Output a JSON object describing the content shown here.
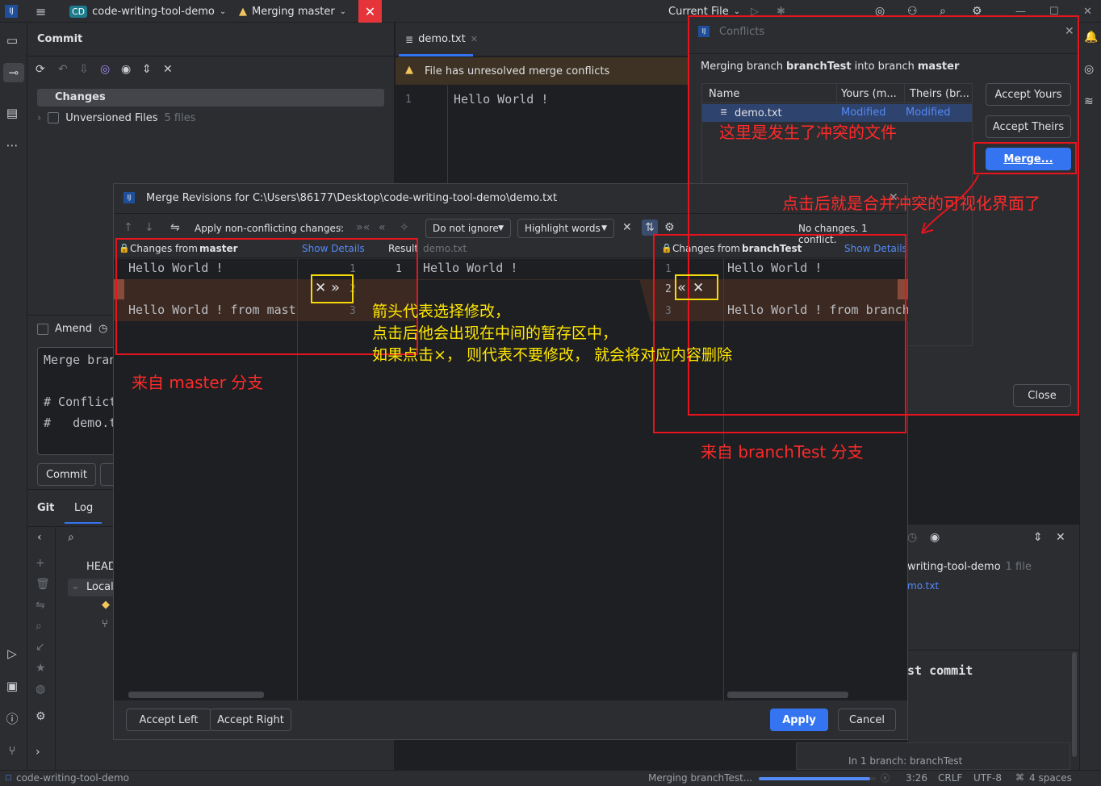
{
  "titlebar": {
    "project_badge": "CD",
    "project_name": "code-writing-tool-demo",
    "branch_status": "Merging master",
    "run_config": "Current File"
  },
  "commit_panel": {
    "title": "Commit",
    "changes_label": "Changes",
    "unversioned_label": "Unversioned Files",
    "unversioned_count": "5 files",
    "amend_label": "Amend",
    "commit_msg_line1": "Merge bran",
    "commit_msg_line3": "# Conflict",
    "commit_msg_line4": "#   demo.t",
    "commit_button": "Commit"
  },
  "git_panel": {
    "tab_git": "Git",
    "tab_log": "Log",
    "head_label": "HEAD",
    "local_label": "Local",
    "repo_label": "writing-tool-demo",
    "repo_files": "1 file",
    "file_label": "mo.txt",
    "commit_title": "st commit",
    "branch_info": "In 1 branch: branchTest"
  },
  "editor": {
    "tab_label": "demo.txt",
    "warning": "File has unresolved merge conflicts",
    "line_number": "1",
    "line_text": "Hello World !"
  },
  "conflicts_dialog": {
    "title": "Conflicts",
    "merging_prefix": "Merging branch",
    "source_branch": "branchTest",
    "merging_mid": "into branch",
    "target_branch": "master",
    "col_name": "Name",
    "col_yours": "Yours (m...",
    "col_theirs": "Theirs (br...",
    "row_file": "demo.txt",
    "row_yours": "Modified",
    "row_theirs": "Modified",
    "accept_yours": "Accept Yours",
    "accept_theirs": "Accept Theirs",
    "merge": "Merge...",
    "close": "Close"
  },
  "merge_dialog": {
    "title": "Merge Revisions for C:\\Users\\86177\\Desktop\\code-writing-tool-demo\\demo.txt",
    "apply_nonconflicting": "Apply non-conflicting changes:",
    "ignore_option": "Do not ignore",
    "highlight_option": "Highlight words",
    "status": "No changes. 1 conflict.",
    "left_header_prefix": "Changes from",
    "left_branch": "master",
    "show_details": "Show Details",
    "result_label": "Result",
    "result_file": "demo.txt",
    "right_header_prefix": "Changes from",
    "right_branch": "branchTest",
    "left_line1": "Hello World !",
    "left_line3": "Hello World ! from mast",
    "center_line1": "Hello World !",
    "right_line1": "Hello World !",
    "right_line3": "Hello World ! from branch",
    "ln1": "1",
    "ln2": "2",
    "ln3": "3",
    "accept_left": "Accept Left",
    "accept_right": "Accept Right",
    "apply": "Apply",
    "cancel": "Cancel"
  },
  "annotations": {
    "conflict_file": "这里是发生了冲突的文件",
    "after_click": "点击后就是合并冲突的可视化界面了",
    "arrow_line1": "箭头代表选择修改，",
    "arrow_line2": "点击后他会出现在中间的暂存区中，",
    "arrow_line3": "如果点击×， 则代表不要修改， 就会将对应内容删除",
    "from_master": "来自 master 分支",
    "from_branchtest": "来自 branchTest 分支"
  },
  "statusbar": {
    "project": "code-writing-tool-demo",
    "task": "Merging branchTest...",
    "task_progress": 0.95,
    "position": "3:26",
    "line_sep": "CRLF",
    "encoding": "UTF-8",
    "indent": "4 spaces"
  },
  "colors": {
    "accent": "#3574f0",
    "annotation_red": "#e5141e",
    "annotation_yellow": "#f5d90a",
    "conflict_bg": "#3c2a22"
  }
}
